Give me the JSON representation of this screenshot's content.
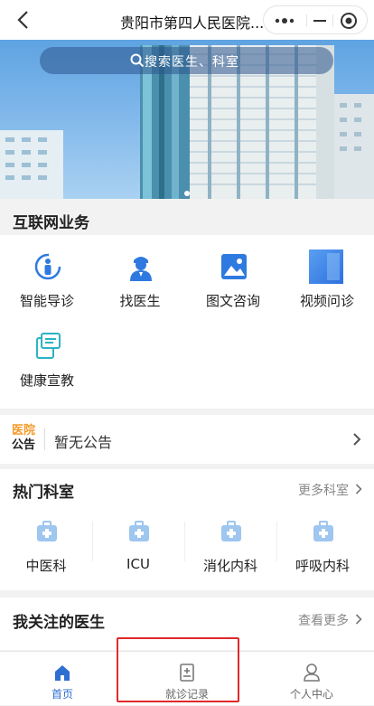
{
  "nav": {
    "title": "贵阳市第四人民医院..."
  },
  "banner": {
    "search_placeholder": "搜索医生、科室"
  },
  "internet": {
    "title": "互联网业务",
    "items": [
      {
        "label": "智能导诊",
        "icon": "guide-person-icon"
      },
      {
        "label": "找医生",
        "icon": "doctor-icon"
      },
      {
        "label": "图文咨询",
        "icon": "image-consult-icon"
      },
      {
        "label": "视频问诊",
        "icon": "video-consult-icon"
      },
      {
        "label": "健康宣教",
        "icon": "health-education-icon"
      }
    ]
  },
  "notice": {
    "badge_line1": "医院",
    "badge_line2": "公告",
    "text": "暂无公告"
  },
  "hot_depts": {
    "title": "热门科室",
    "more": "更多科室",
    "items": [
      {
        "label": "中医科"
      },
      {
        "label": "ICU"
      },
      {
        "label": "消化内科"
      },
      {
        "label": "呼吸内科"
      }
    ]
  },
  "fav_doctors": {
    "title": "我关注的医生",
    "more": "查看更多"
  },
  "tabbar": {
    "items": [
      {
        "label": "首页",
        "active": true
      },
      {
        "label": "就诊记录",
        "active": false
      },
      {
        "label": "个人中心",
        "active": false
      }
    ]
  },
  "colors": {
    "accent": "#2f6fd1",
    "notice_orange": "#f39a2b",
    "highlight": "#e02a2a"
  }
}
